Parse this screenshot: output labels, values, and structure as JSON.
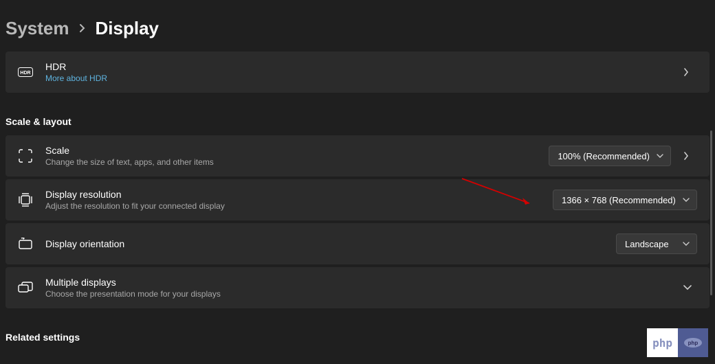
{
  "breadcrumb": {
    "parent": "System",
    "current": "Display"
  },
  "hdr": {
    "title": "HDR",
    "link_text": "More about HDR"
  },
  "sections": {
    "scale_layout": "Scale & layout",
    "related": "Related settings"
  },
  "scale": {
    "title": "Scale",
    "subtitle": "Change the size of text, apps, and other items",
    "value": "100% (Recommended)"
  },
  "resolution": {
    "title": "Display resolution",
    "subtitle": "Adjust the resolution to fit your connected display",
    "value": "1366 × 768 (Recommended)"
  },
  "orientation": {
    "title": "Display orientation",
    "value": "Landscape"
  },
  "multiple": {
    "title": "Multiple displays",
    "subtitle": "Choose the presentation mode for your displays"
  },
  "watermark": {
    "text": "php"
  }
}
